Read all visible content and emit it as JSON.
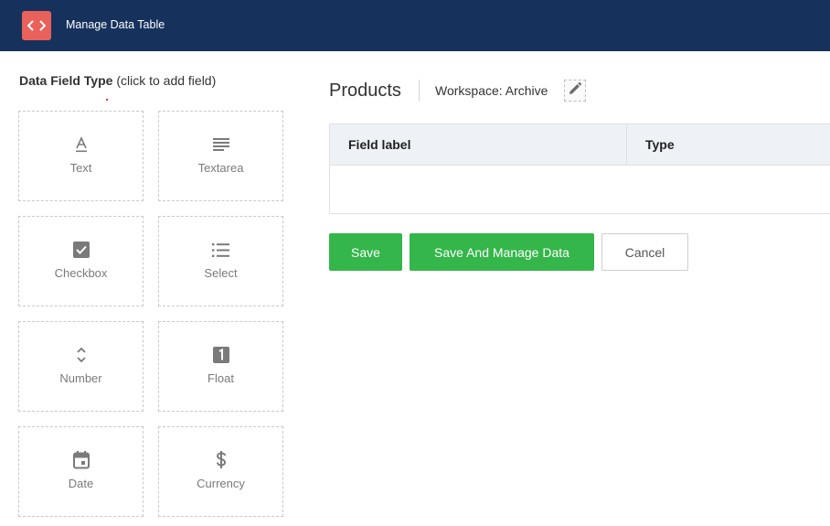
{
  "header": {
    "title": "Manage Data Table",
    "logo_icon": "code-brackets-icon",
    "background": "#16325c",
    "logo_color": "#e8615a"
  },
  "field_panel": {
    "heading_bold": "Data Field Type",
    "heading_hint": "(click to add field)",
    "fields": [
      {
        "label": "Text",
        "icon": "text-format-icon"
      },
      {
        "label": "Textarea",
        "icon": "textarea-lines-icon"
      },
      {
        "label": "Checkbox",
        "icon": "checkbox-icon"
      },
      {
        "label": "Select",
        "icon": "list-icon"
      },
      {
        "label": "Number",
        "icon": "up-down-chevron-icon"
      },
      {
        "label": "Float",
        "icon": "number-one-box-icon"
      },
      {
        "label": "Date",
        "icon": "calendar-icon"
      },
      {
        "label": "Currency",
        "icon": "dollar-icon"
      }
    ]
  },
  "main": {
    "table_name": "Products",
    "workspace": "Workspace: Archive",
    "edit_icon": "pencil-icon",
    "columns": [
      "Field label",
      "Type"
    ]
  },
  "actions": {
    "save": "Save",
    "save_manage": "Save And Manage Data",
    "cancel": "Cancel",
    "primary_color": "#34b64a"
  }
}
